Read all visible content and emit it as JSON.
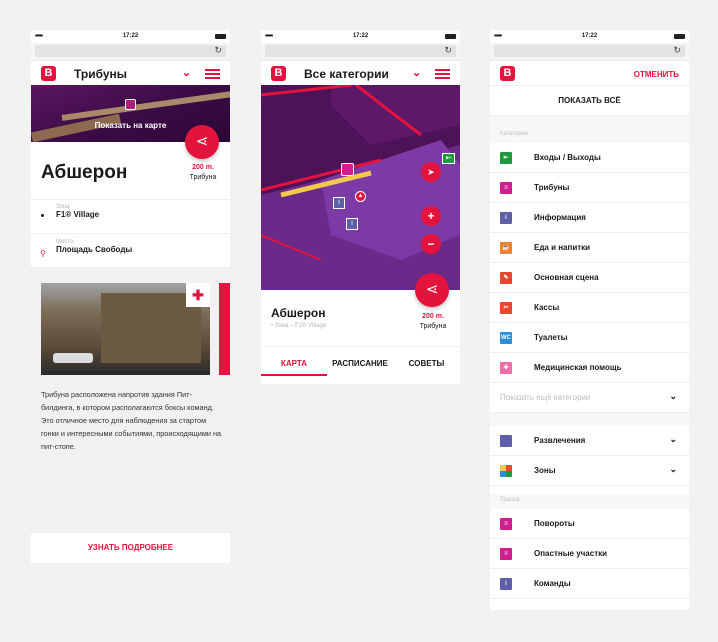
{
  "status_bar": {
    "dots": "•••••",
    "time": "17:22"
  },
  "screen1": {
    "header_title": "Трибуны",
    "show_on_map": "Показать на карте",
    "title": "Абшерон",
    "distance": "200 m.",
    "distance_type": "Трибуна",
    "zone_label": "Зона",
    "zone_value": "F1® Village",
    "place_label": "Место",
    "place_value": "Площадь Свободы",
    "description": "Трибуна расположена напротив здания Пит-билдинга, в котором располагаются боксы команд. Это отличное место для наблюдения за стартом гонки и интересными событиями, происходящими на пит-стопе.",
    "more_button": "УЗНАТЬ ПОДРОБНЕЕ"
  },
  "screen2": {
    "header_title": "Все категории",
    "title": "Абшерон",
    "subtitle": "Зона – F1® Village",
    "distance": "200 m.",
    "distance_type": "Трибуна",
    "tabs": [
      "КАРТА",
      "РАСПИСАНИЕ",
      "СОВЕТЫ"
    ]
  },
  "screen3": {
    "cancel": "ОТМЕНИТЬ",
    "show_all": "ПОКАЗАТЬ ВСЁ",
    "categories_title": "Категории",
    "categories": [
      {
        "label": "Входы / Выходы",
        "color": "#1f9a3e",
        "icon": "exit-icon"
      },
      {
        "label": "Трибуны",
        "color": "#d21d8f",
        "icon": "stand-icon"
      },
      {
        "label": "Информация",
        "color": "#5d5fa8",
        "icon": "info-icon"
      },
      {
        "label": "Еда и напитки",
        "color": "#f0812f",
        "icon": "food-icon"
      },
      {
        "label": "Основная сцена",
        "color": "#e8462f",
        "icon": "stage-icon"
      },
      {
        "label": "Кассы",
        "color": "#e8462f",
        "icon": "ticket-icon"
      },
      {
        "label": "Туалеты",
        "color": "#2b8ed6",
        "icon": "wc-icon"
      },
      {
        "label": "Медицинская помощь",
        "color": "#f06ea7",
        "icon": "medical-icon"
      }
    ],
    "more_categories": "Показать ещё категории",
    "entertainment": "Развлечения",
    "zones": "Зоны",
    "track_title": "Трасса",
    "track": [
      {
        "label": "Повороты",
        "color": "#d21d8f",
        "icon": "turn-icon"
      },
      {
        "label": "Опастные участки",
        "color": "#d21d8f",
        "icon": "danger-icon"
      },
      {
        "label": "Команды",
        "color": "#5d5fa8",
        "icon": "team-icon"
      }
    ]
  }
}
